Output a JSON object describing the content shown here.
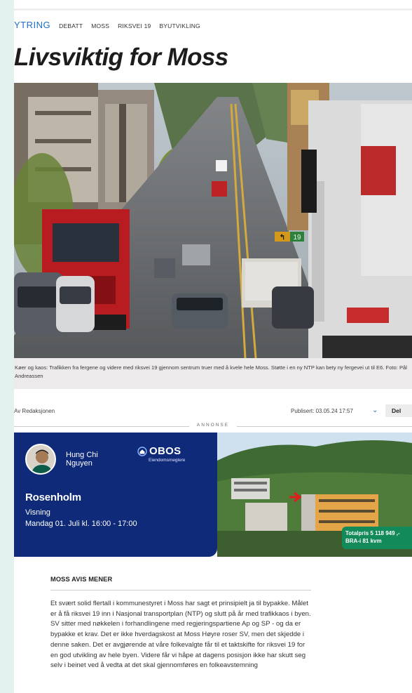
{
  "breadcrumb": {
    "section": "YTRING",
    "items": [
      "DEBATT",
      "MOSS",
      "RIKSVEI 19",
      "BYUTVIKLING"
    ]
  },
  "article": {
    "title": "Livsviktig for Moss",
    "caption": "Køer og kaos: Trafikken fra fergene og videre med riksvei 19 gjennom sentrum truer med å kvele hele Moss. Støtte i en ny NTP kan bety ny fergevei ut til E6. Foto: Pål Andreassen",
    "byline": "Av Redaksjonen",
    "published": "Publisert: 03.05.24 17:57",
    "share_label": "Del",
    "kicker": "MOSS AVIS MENER",
    "body": "Et svært solid flertall i kommunestyret i Moss har sagt et prinsipielt ja til bypakke. Målet er å få riksvei 19 inn i Nasjonal transportplan (NTP) og slutt på år med trafikkaos i byen. SV sitter med nøkkelen i forhandlingene med regjeringspartiene Ap og SP - og da er bypakke et krav. Det er ikke hverdagskost at Moss Høyre roser SV, men det skjedde i denne saken. Det er avgjørende at våre folkevalgte får til et taktskifte for riksvei 19 for en god utvikling av hele byen. Videre får vi håpe at dagens posisjon ikke har skutt seg selv i beinet ved å vedta at det skal gjennomføres en folkeavstemning"
  },
  "road_signs": {
    "arrow_sign": "↰",
    "route_number": "19"
  },
  "ad": {
    "label": "ANNONSE",
    "agent_first": "Hung Chi",
    "agent_last": "Nguyen",
    "brand": "OBOS",
    "brand_sub": "Eiendomsmeglere",
    "place": "Rosenholm",
    "event": "Visning",
    "when": "Mandag 01. Juli kl. 16:00 - 17:00",
    "price_line1": "Totalpris 5 118 949 ,-",
    "price_line2": "BRA-i 81 kvm"
  },
  "colors": {
    "accent": "#1b6fc4",
    "ad_navy": "#0f2a78",
    "price_green": "#138a5a",
    "page_bg": "#e3f1ef"
  },
  "icons": {
    "chevron": "chevron-down-icon",
    "obos_logo": "obos-house-icon",
    "arrow": "red-arrow-icon"
  }
}
